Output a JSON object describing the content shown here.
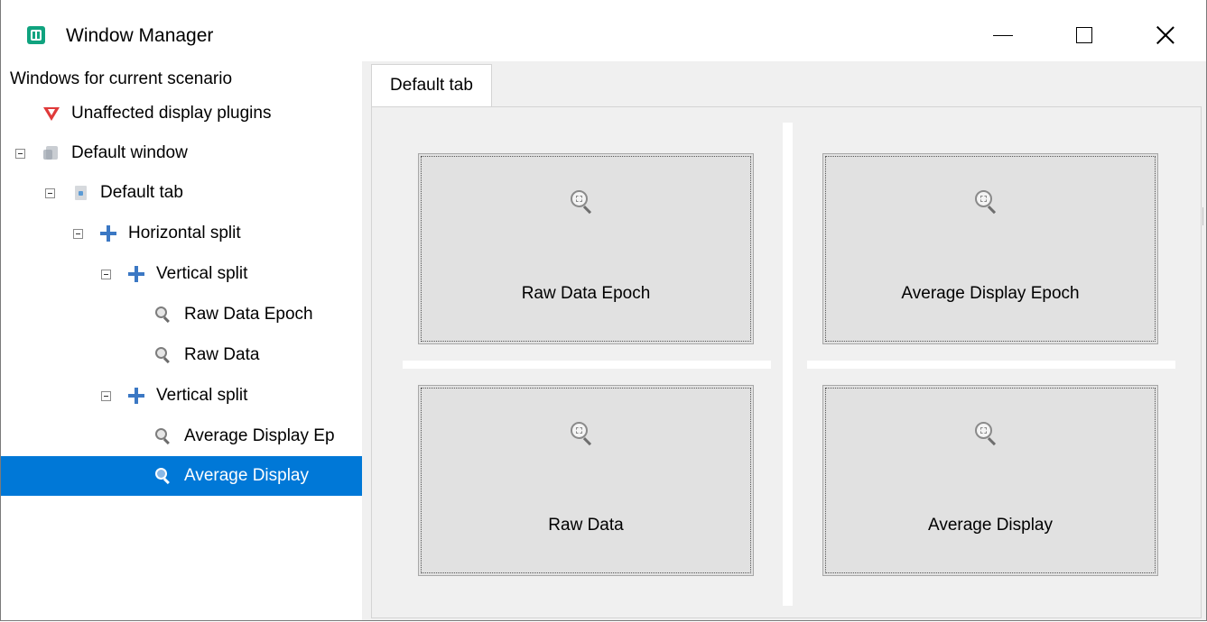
{
  "window": {
    "title": "Window Manager"
  },
  "tree": {
    "heading": "Windows for current scenario",
    "nodes": [
      {
        "label": "Unaffected display plugins",
        "icon": "plugin-icon"
      },
      {
        "label": "Default window",
        "icon": "window-icon"
      },
      {
        "label": "Default tab",
        "icon": "tab-icon"
      },
      {
        "label": "Horizontal split",
        "icon": "split-icon"
      },
      {
        "label": "Vertical split",
        "icon": "split-icon"
      },
      {
        "label": "Raw Data Epoch",
        "icon": "magnifier-icon"
      },
      {
        "label": "Raw Data",
        "icon": "magnifier-icon"
      },
      {
        "label": "Vertical split",
        "icon": "split-icon"
      },
      {
        "label": "Average Display Ep",
        "icon": "magnifier-icon"
      },
      {
        "label": "Average Display",
        "icon": "magnifier-icon",
        "selected": true
      }
    ]
  },
  "tabs": [
    {
      "label": "Default tab",
      "active": true
    }
  ],
  "panels": [
    {
      "label": "Raw Data Epoch"
    },
    {
      "label": "Average Display Epoch"
    },
    {
      "label": "Raw Data"
    },
    {
      "label": "Average Display"
    }
  ],
  "colors": {
    "selection": "#0078d7",
    "app_icon": "#10a37f",
    "split_icon": "#3b78c4",
    "plugin_icon": "#e03a3a"
  }
}
